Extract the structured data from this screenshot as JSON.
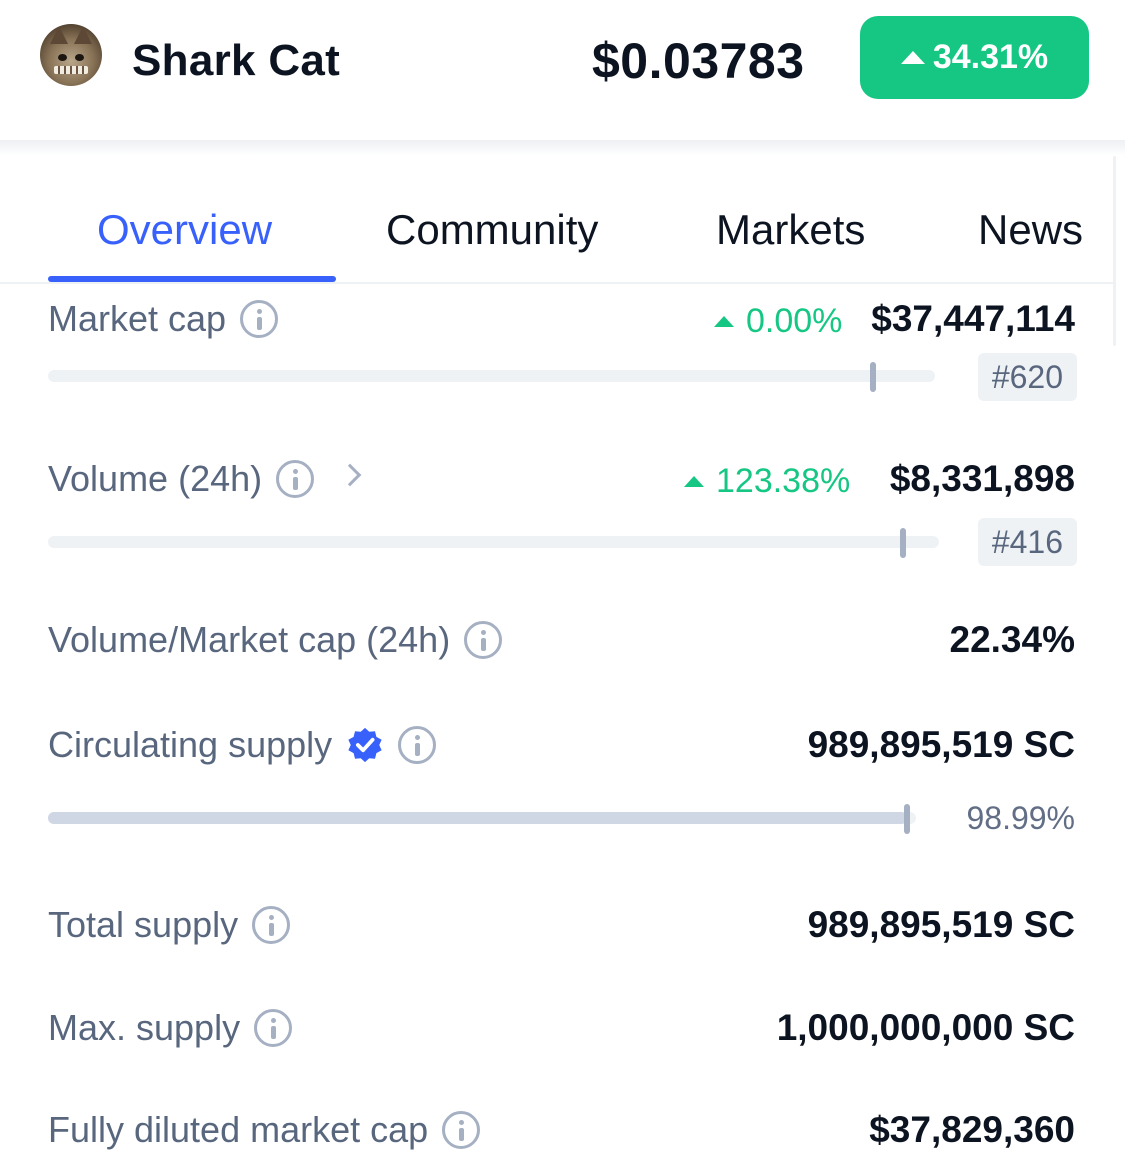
{
  "header": {
    "coin_name": "Shark Cat",
    "price": "$0.03783",
    "change_24h": "34.31%",
    "change_color": "#16c784",
    "logo_icon": "shark-cat-logo"
  },
  "tabs": [
    {
      "label": "Overview",
      "active": true
    },
    {
      "label": "Community",
      "active": false
    },
    {
      "label": "Markets",
      "active": false
    },
    {
      "label": "News",
      "active": false
    }
  ],
  "stats": {
    "market_cap": {
      "label": "Market cap",
      "change": "0.00%",
      "value": "$37,447,114",
      "rank": "#620",
      "bar_position": 0.93
    },
    "volume_24h": {
      "label": "Volume (24h)",
      "change": "123.38%",
      "value": "$8,331,898",
      "rank": "#416",
      "bar_position": 0.96
    },
    "volume_market_cap": {
      "label": "Volume/Market cap (24h)",
      "value": "22.34%"
    },
    "circulating_supply": {
      "label": "Circulating supply",
      "value": "989,895,519 SC",
      "percent": "98.99%",
      "fill": 0.9899
    },
    "total_supply": {
      "label": "Total supply",
      "value": "989,895,519 SC"
    },
    "max_supply": {
      "label": "Max. supply",
      "value": "1,000,000,000 SC"
    },
    "fully_diluted_market_cap": {
      "label": "Fully diluted market cap",
      "value": "$37,829,360"
    }
  },
  "colors": {
    "accent": "#3861fb",
    "positive": "#16c784",
    "label": "#58667e"
  }
}
